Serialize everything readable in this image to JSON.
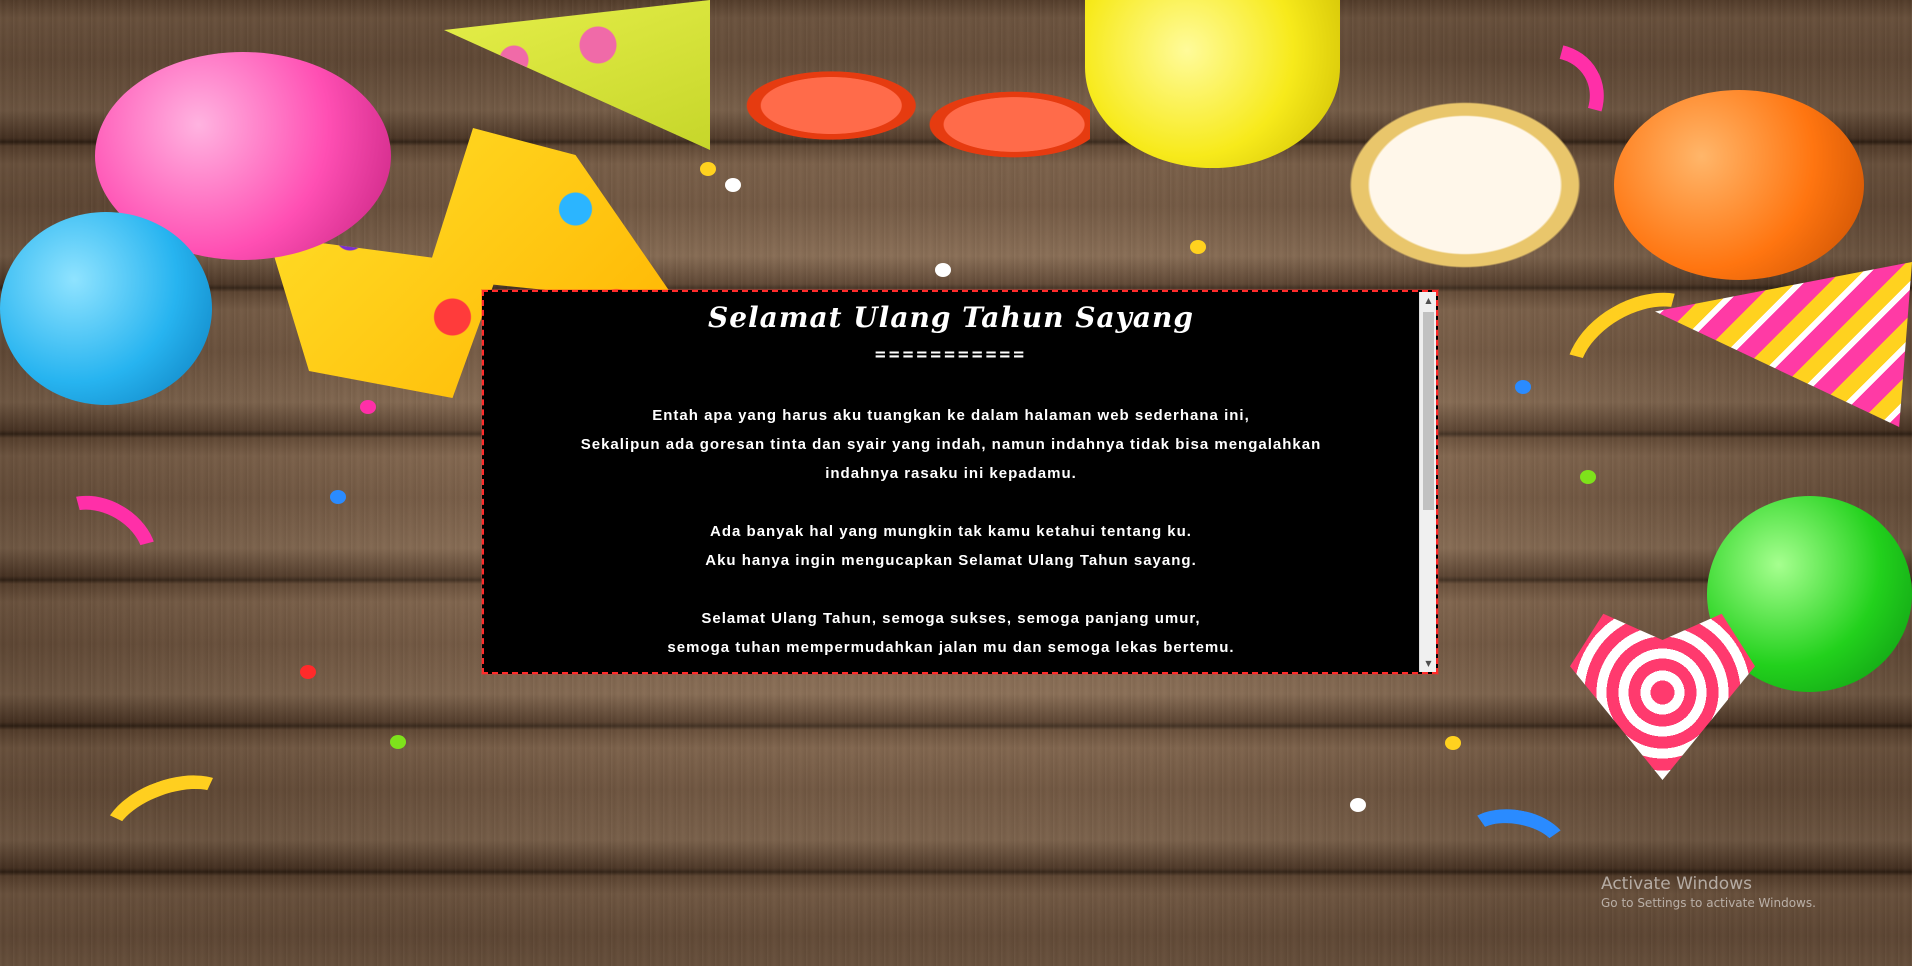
{
  "message": {
    "title": "Selamat Ulang Tahun Sayang",
    "divider": "===========",
    "paragraphs": [
      [
        "Entah apa yang harus aku tuangkan ke dalam halaman web sederhana ini,",
        "Sekalipun ada goresan tinta dan syair yang indah, namun indahnya tidak bisa mengalahkan",
        "indahnya rasaku ini kepadamu."
      ],
      [
        "Ada banyak hal yang mungkin tak kamu ketahui tentang ku.",
        "Aku hanya ingin mengucapkan Selamat Ulang Tahun sayang."
      ],
      [
        "Selamat Ulang Tahun, semoga sukses, semoga panjang umur,",
        "semoga tuhan mempermudahkan jalan mu dan semoga lekas bertemu."
      ]
    ]
  },
  "scrollbar": {
    "up_icon": "scroll-up-arrow-icon",
    "down_icon": "scroll-down-arrow-icon",
    "up_glyph": "▲",
    "down_glyph": "▼"
  },
  "watermark": {
    "title": "Activate Windows",
    "subtitle": "Go to Settings to activate Windows."
  },
  "colors": {
    "box_background": "#000000",
    "box_border": "#ff2a2a",
    "text": "#ffffff"
  }
}
